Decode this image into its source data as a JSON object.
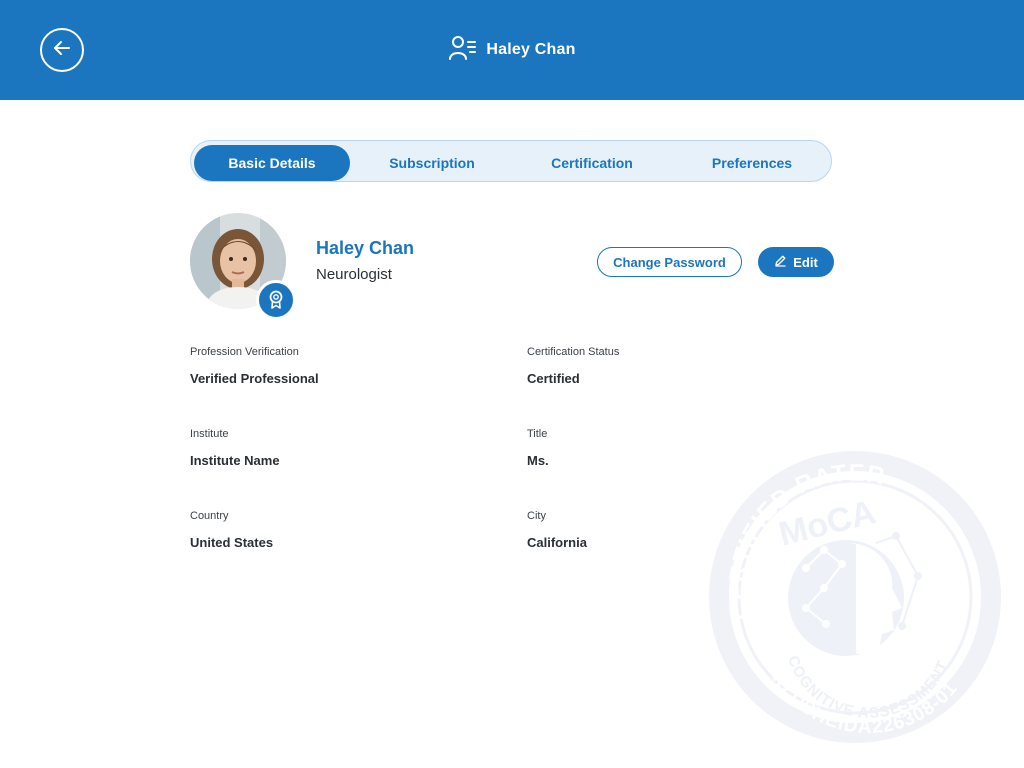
{
  "header": {
    "title": "Haley Chan",
    "back_icon": "arrow-left-icon",
    "user_icon": "user-list-icon"
  },
  "tabs": [
    {
      "label": "Basic Details",
      "active": true
    },
    {
      "label": "Subscription",
      "active": false
    },
    {
      "label": "Certification",
      "active": false
    },
    {
      "label": "Preferences",
      "active": false
    }
  ],
  "profile": {
    "name": "Haley Chan",
    "role": "Neurologist",
    "badge_icon": "award-ribbon-icon"
  },
  "actions": {
    "change_password": "Change Password",
    "edit": "Edit",
    "edit_icon": "pencil-icon"
  },
  "fields": {
    "profession_verification": {
      "label": "Profession Verification",
      "value": "Verified Professional"
    },
    "certification_status": {
      "label": "Certification Status",
      "value": "Certified"
    },
    "institute": {
      "label": "Institute",
      "value": "Institute Name"
    },
    "title": {
      "label": "Title",
      "value": "Ms."
    },
    "country": {
      "label": "Country",
      "value": "United States"
    },
    "city": {
      "label": "City",
      "value": "California"
    }
  },
  "watermark": {
    "top_text": "CERTIFIED RATER",
    "logo_text": "MoCA",
    "middle_text": "COGNITIVE ASSESSMENT",
    "id_text": "ID USHEIDA226308-01"
  },
  "colors": {
    "primary": "#1b76bf",
    "tab_bg": "#e7f1fa",
    "watermark": "#c9d1ea"
  }
}
